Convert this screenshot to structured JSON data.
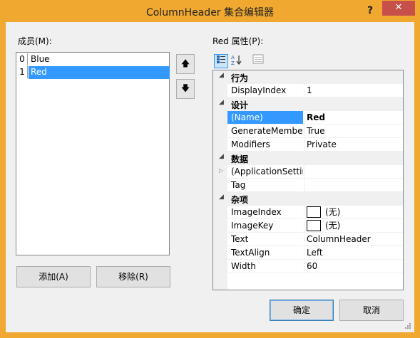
{
  "window": {
    "title": "ColumnHeader 集合编辑器",
    "help_label": "?",
    "close_label": "✕"
  },
  "members": {
    "label": "成员(M):",
    "items": [
      {
        "index": "0",
        "name": "Blue"
      },
      {
        "index": "1",
        "name": "Red"
      }
    ],
    "up_label": "🡅",
    "down_label": "🡇",
    "add_label": "添加(A)",
    "remove_label": "移除(R)"
  },
  "properties": {
    "label": "Red 属性(P):",
    "categories": [
      {
        "name": "行为",
        "rows": [
          {
            "name": "DisplayIndex",
            "value": "1"
          }
        ]
      },
      {
        "name": "设计",
        "rows": [
          {
            "name": "(Name)",
            "value": "Red"
          },
          {
            "name": "GenerateMembe",
            "value": "True"
          },
          {
            "name": "Modifiers",
            "value": "Private"
          }
        ]
      },
      {
        "name": "数据",
        "rows": [
          {
            "name": "(ApplicationSettin",
            "value": ""
          },
          {
            "name": "Tag",
            "value": ""
          }
        ]
      },
      {
        "name": "杂项",
        "rows": [
          {
            "name": "ImageIndex",
            "value": "(无)"
          },
          {
            "name": "ImageKey",
            "value": "(无)"
          },
          {
            "name": "Text",
            "value": "ColumnHeader"
          },
          {
            "name": "TextAlign",
            "value": "Left"
          },
          {
            "name": "Width",
            "value": "60"
          }
        ]
      }
    ]
  },
  "footer": {
    "ok_label": "确定",
    "cancel_label": "取消"
  },
  "colors": {
    "frame": "#f0a830",
    "selection": "#3399ff",
    "close": "#c7504a"
  }
}
